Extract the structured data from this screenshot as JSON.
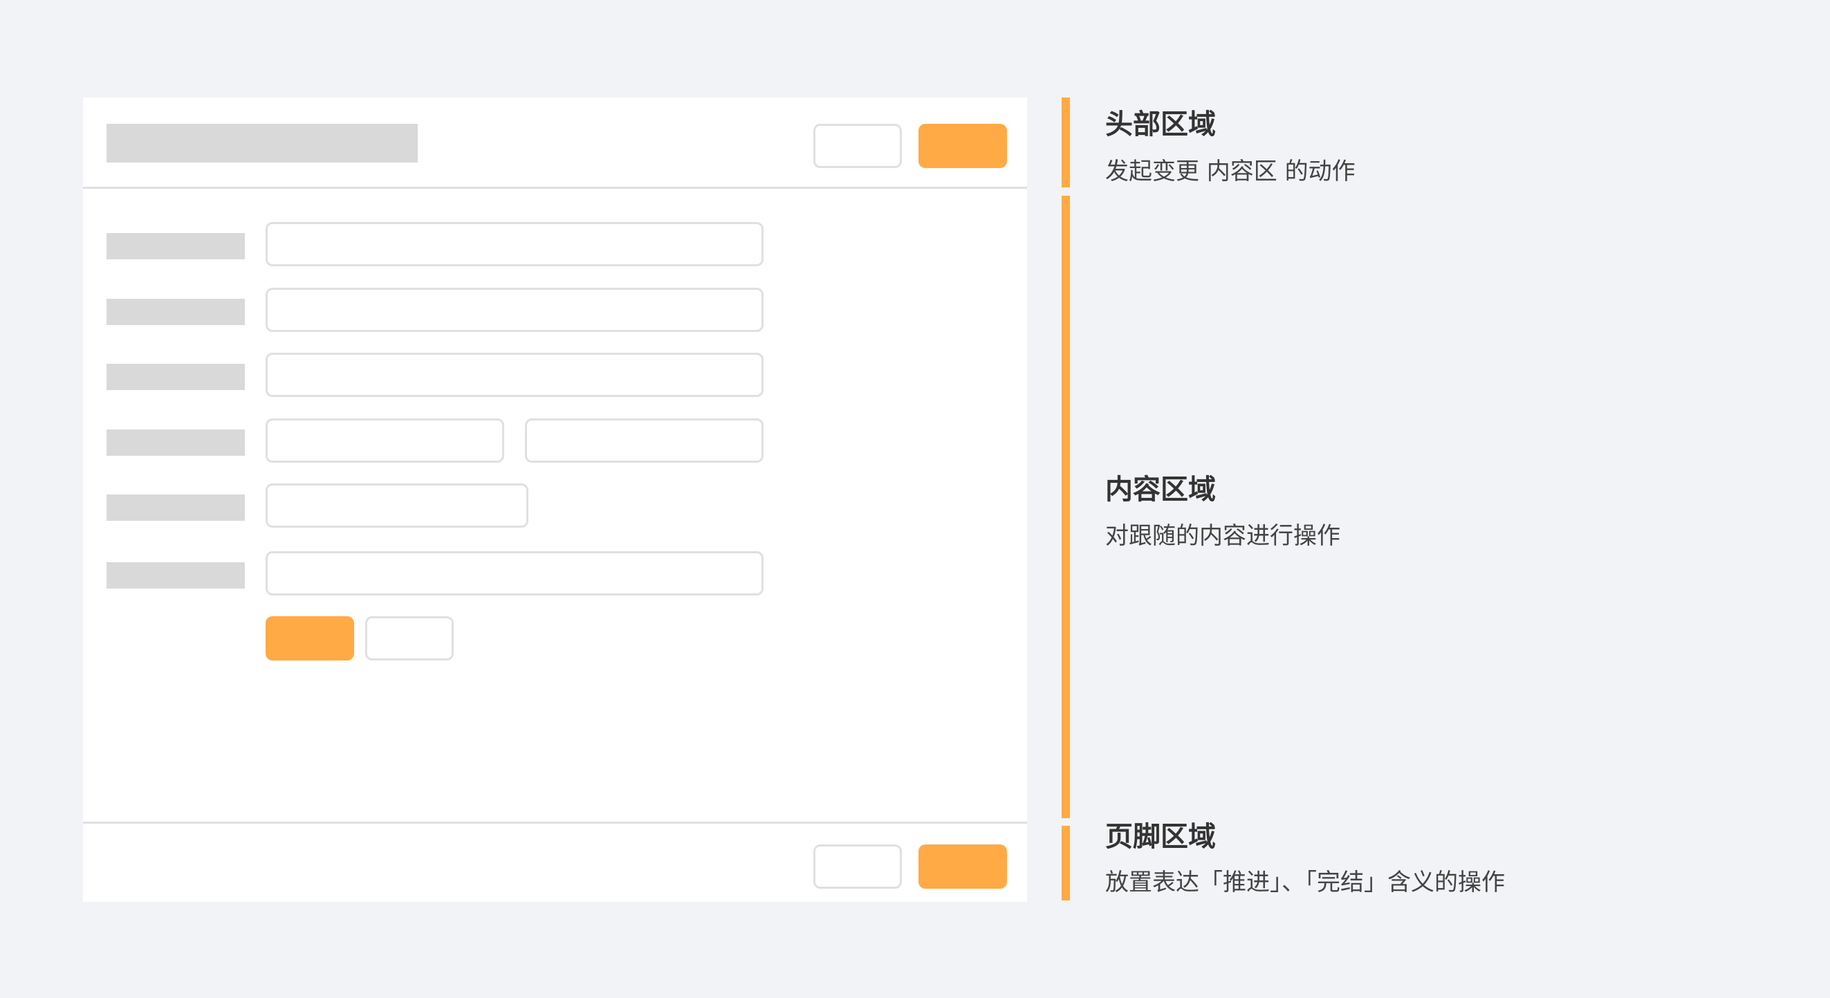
{
  "annotations": {
    "header": {
      "title": "头部区域",
      "description": "发起变更 内容区 的动作"
    },
    "content": {
      "title": "内容区域",
      "description": "对跟随的内容进行操作"
    },
    "footer": {
      "title": "页脚区域",
      "description": "放置表达「推进」、「完结」含义的操作"
    }
  },
  "colors": {
    "background": "#f2f3f7",
    "panel": "#ffffff",
    "placeholder": "#d9d9d9",
    "border": "#e0e0e0",
    "accent": "#ffaa44",
    "title_text": "#333333",
    "description_text": "#444444"
  }
}
